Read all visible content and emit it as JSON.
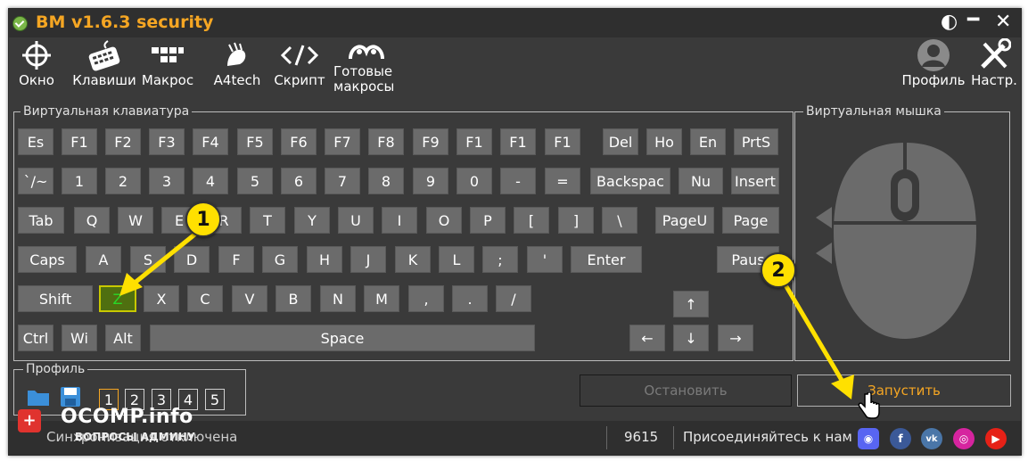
{
  "app": {
    "title": "BM v1.6.3 security"
  },
  "window_controls": {
    "theme": "◐",
    "minimize": "━",
    "close": "✕"
  },
  "toolbar": {
    "items": [
      {
        "label": "Окно",
        "icon": "crosshair-icon"
      },
      {
        "label": "Клавиши",
        "icon": "keyboard-icon"
      },
      {
        "label": "Макрос",
        "icon": "macro-keys-icon"
      },
      {
        "label": "A4tech",
        "icon": "a4tech-logo-icon"
      },
      {
        "label": "Скрипт",
        "icon": "code-icon"
      },
      {
        "label": "Готовые\nмакросы",
        "icon": "ready-macros-icon"
      },
      {
        "label": "Профиль",
        "icon": "profile-icon"
      },
      {
        "label": "Настр.",
        "icon": "settings-icon"
      }
    ]
  },
  "keyboard": {
    "legend": "Виртуальная клавиатура",
    "rows": [
      [
        "Es",
        "F1",
        "F2",
        "F3",
        "F4",
        "F5",
        "F6",
        "F7",
        "F8",
        "F9",
        "F1",
        "F1",
        "F1",
        "Del",
        "Ho",
        "En",
        "PrtS"
      ],
      [
        "`/~",
        "1",
        "2",
        "3",
        "4",
        "5",
        "6",
        "7",
        "8",
        "9",
        "0",
        "-",
        "=",
        "Backspac",
        "Nu",
        "Insert"
      ],
      [
        "Tab",
        "Q",
        "W",
        "E",
        "R",
        "T",
        "Y",
        "U",
        "I",
        "O",
        "P",
        "[",
        "]",
        "\\",
        "PageU",
        "Page"
      ],
      [
        "Caps",
        "A",
        "S",
        "D",
        "F",
        "G",
        "H",
        "J",
        "K",
        "L",
        ";",
        "'",
        "Enter",
        "Paus"
      ],
      [
        "Shift",
        "Z",
        "X",
        "C",
        "V",
        "B",
        "N",
        "M",
        ",",
        ".",
        "/",
        "↑"
      ],
      [
        "Ctrl",
        "Wi",
        "Alt",
        "Space",
        "←",
        "↓",
        "→"
      ]
    ],
    "highlighted_key": "Z"
  },
  "mouse": {
    "legend": "Виртуальная мышка"
  },
  "profile": {
    "legend": "Профиль",
    "slots": [
      "1",
      "2",
      "3",
      "4",
      "5"
    ],
    "active_slot": "1",
    "open_icon": "folder-icon",
    "save_icon": "save-icon"
  },
  "actions": {
    "stop_label": "Остановить",
    "start_label": "Запустить"
  },
  "status": {
    "sync_text": "Синхронизация отключена",
    "count": "9615",
    "join_text": "Присоединяйтесь к нам",
    "socials": [
      "discord-icon",
      "facebook-icon",
      "vk-icon",
      "instagram-icon",
      "youtube-icon"
    ]
  },
  "annotations": {
    "marker1": "1",
    "marker2": "2"
  },
  "watermark": {
    "site": "OCOMP.info",
    "tagline": "ВОПРОСЫ АДМИНУ"
  },
  "colors": {
    "accent": "#f5a623",
    "window_bg": "#3a3a3a",
    "key_bg": "#6b6b6b",
    "highlight": "#28d828"
  }
}
